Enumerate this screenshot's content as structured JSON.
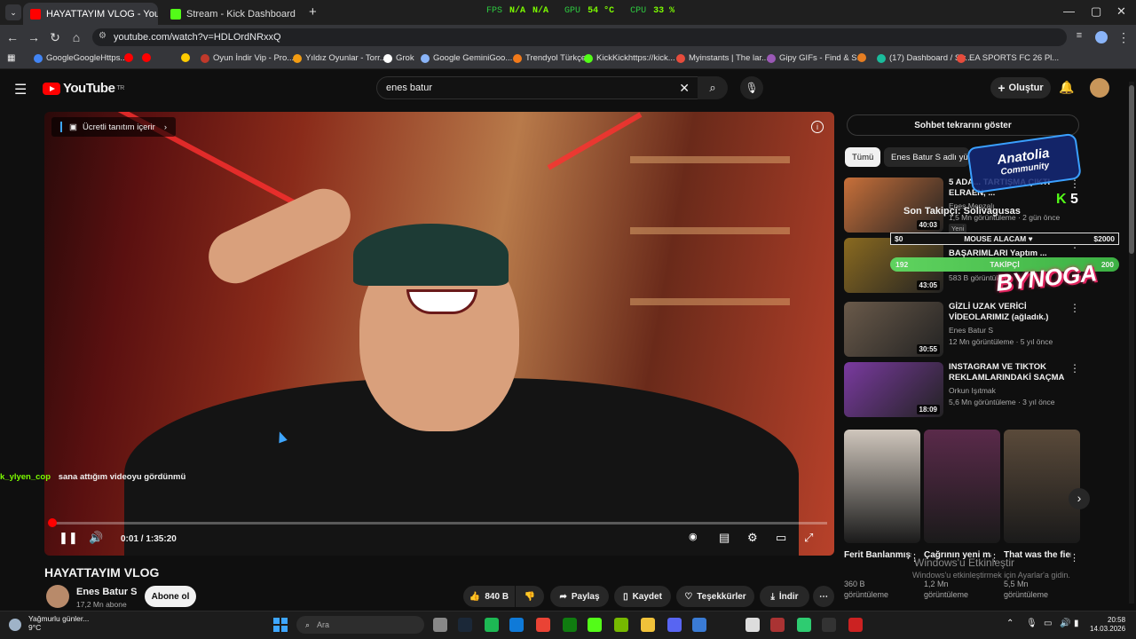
{
  "browser": {
    "tabs": [
      {
        "title": "HAYATTAYIM VLOG - YouTu...",
        "active": true,
        "favicon_color": "#ff0000"
      },
      {
        "title": "Stream - Kick Dashboard",
        "active": false,
        "favicon_color": "#53fc18"
      }
    ],
    "new_tab_label": "+",
    "hud": {
      "fps_label": "FPS",
      "fps_value": "N/A",
      "fps_value2": "N/A",
      "gpu_label": "GPU",
      "gpu_value": "54 °C",
      "cpu_label": "CPU",
      "cpu_value": "33 %"
    },
    "url": "youtube.com/watch?v=HDLOrdNRxxQ",
    "bookmarks": [
      {
        "label": "GoogleGoogleHttps...",
        "color": "#4285f4"
      },
      {
        "label": "",
        "color": "#ff0000"
      },
      {
        "label": "",
        "color": "#ff0000"
      },
      {
        "label": "",
        "color": "#ffcc00"
      },
      {
        "label": "Oyun İndir Vip - Pro...",
        "color": "#c0392b"
      },
      {
        "label": "Yıldız Oyunlar - Torr...",
        "color": "#f39c12"
      },
      {
        "label": "Grok",
        "color": "#ffffff"
      },
      {
        "label": "Google GeminiGoo...",
        "color": "#8ab4f8"
      },
      {
        "label": "Trendyol Türkçe",
        "color": "#f27a1a"
      },
      {
        "label": "KickKickhttps://kick...",
        "color": "#53fc18"
      },
      {
        "label": "Myinstants | The lar...",
        "color": "#e74c3c"
      },
      {
        "label": "Gipy GIFs - Find & S...",
        "color": "#9b59b6"
      },
      {
        "label": "",
        "color": "#e67e22"
      },
      {
        "label": "(17) Dashboard / Str...",
        "color": "#1abc9c"
      },
      {
        "label": "EA SPORTS FC 26 Pl...",
        "color": "#e74c3c"
      }
    ]
  },
  "youtube": {
    "logo_text": "YouTube",
    "logo_sup": "TR",
    "search_value": "enes batur",
    "create_label": "Oluştur"
  },
  "video": {
    "paid_badge": "Ücretli tanıtım içerir",
    "time": "0:01 / 1:35:20",
    "progress_fraction": 0.001,
    "chat_user": "k_ylyen_cop",
    "chat_message": "sana attığım videoyu gördünmü",
    "title": "HAYATTAYIM VLOG",
    "channel": "Enes Batur S",
    "subscribers": "17,2 Mn abone",
    "subscribe_label": "Abone ol",
    "likes": "840 B",
    "share_label": "Paylaş",
    "save_label": "Kaydet",
    "thanks_label": "Teşekkürler",
    "download_label": "İndir",
    "more_label": "⋯"
  },
  "sidebar": {
    "chat_replay": "Sohbet tekrarını göster",
    "chips": [
      "Tümü",
      "Enes Batur S adlı yük..."
    ],
    "recommendations": [
      {
        "title": "5 ADA... TARTIŞMA ÇIKTI ELRAEN, ...",
        "channel": "Enes Menzalı",
        "meta": "1,5 Mn görüntüleme · 2 gün önce",
        "duration": "40:03",
        "badge": "Yeni",
        "thumb": "#c8703a"
      },
      {
        "title": "Minecraft'ta TÜM BAŞARIMLARI Yaptım ...",
        "channel": "",
        "meta": "583 B görüntüleme",
        "duration": "43:05",
        "badge": "",
        "thumb": "#8a6a20"
      },
      {
        "title": "GİZLİ UZAK VERİCİ VİDEOLARIMIZ (ağladık.) #ndng",
        "channel": "Enes Batur S",
        "meta": "12 Mn görüntüleme · 5 yıl önce",
        "duration": "30:55",
        "badge": "",
        "thumb": "#6a5a4a"
      },
      {
        "title": "INSTAGRAM VE TIKTOK REKLAMLARINDAKİ SAÇMA ...",
        "channel": "Orkun Işıtmak",
        "meta": "5,6 Mn görüntüleme · 3 yıl önce",
        "duration": "18:09",
        "badge": "",
        "thumb": "#7a3aa0"
      }
    ],
    "shorts": [
      {
        "title": "Ferit Banlanmışş...",
        "views_line1": "360 B",
        "views_line2": "görüntüleme",
        "thumb": "#cfc6bc"
      },
      {
        "title": "Çağrının yeni manitası",
        "views_line1": "1,2 Mn",
        "views_line2": "görüntüleme",
        "thumb": "#5a2a4a"
      },
      {
        "title": "That was the fiercest ...",
        "views_line1": "5,5 Mn",
        "views_line2": "görüntüleme",
        "thumb": "#5a4a3a"
      }
    ]
  },
  "overlays": {
    "anatolia_line1": "Anatolia",
    "anatolia_line2": "Community",
    "kick_count": "5",
    "last_follower": "Son Takipçi: Solivagusas",
    "goal_left": "$0",
    "goal_text": "MOUSE ALACAM ♥",
    "goal_right": "$2000",
    "follow_current": "192",
    "follow_label": "TAKİPÇİ",
    "follow_target": "200",
    "brand": "BYNOGA",
    "watermark_title": "Windows'u Etkinleştir",
    "watermark_sub": "Windows'u etkinleştirmek için Ayarlar'a gidin."
  },
  "taskbar": {
    "weather_text": "Yağmurlu günler...",
    "weather_temp": "9°C",
    "search_placeholder": "Ara",
    "time": "20:58",
    "date": "14.03.2026"
  }
}
